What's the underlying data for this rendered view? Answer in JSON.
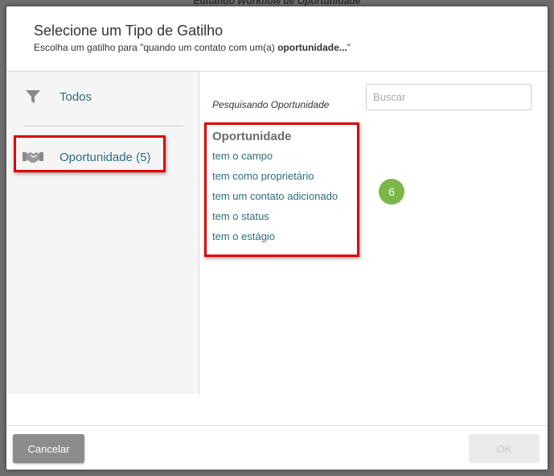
{
  "background": {
    "window_title": "Editando Workflow de Oportunidade"
  },
  "modal": {
    "title": "Selecione um Tipo de Gatilho",
    "subtitle_prefix": "Escolha um gatilho para \"quando um contato com um(a) ",
    "subtitle_bold": "oportunidade...",
    "subtitle_suffix": "\""
  },
  "categories": {
    "todos": {
      "label": "Todos",
      "icon": "filter-icon"
    },
    "oportunidade": {
      "label": "Oportunidade (5)",
      "icon": "handshake-icon"
    }
  },
  "search": {
    "label": "Pesquisando Oportunidade",
    "placeholder": "Buscar",
    "value": ""
  },
  "trigger_group": {
    "title": "Oportunidade",
    "items": [
      "tem o campo",
      "tem como proprietário",
      "tem um contato adicionado",
      "tem o status",
      "tem o estágio"
    ]
  },
  "annotation": {
    "badge": "6"
  },
  "footer": {
    "cancel_label": "Cancelar",
    "ok_label": "OK"
  },
  "colors": {
    "link": "#2d6e78",
    "highlight": "#e00000",
    "badge": "#7ab648"
  }
}
